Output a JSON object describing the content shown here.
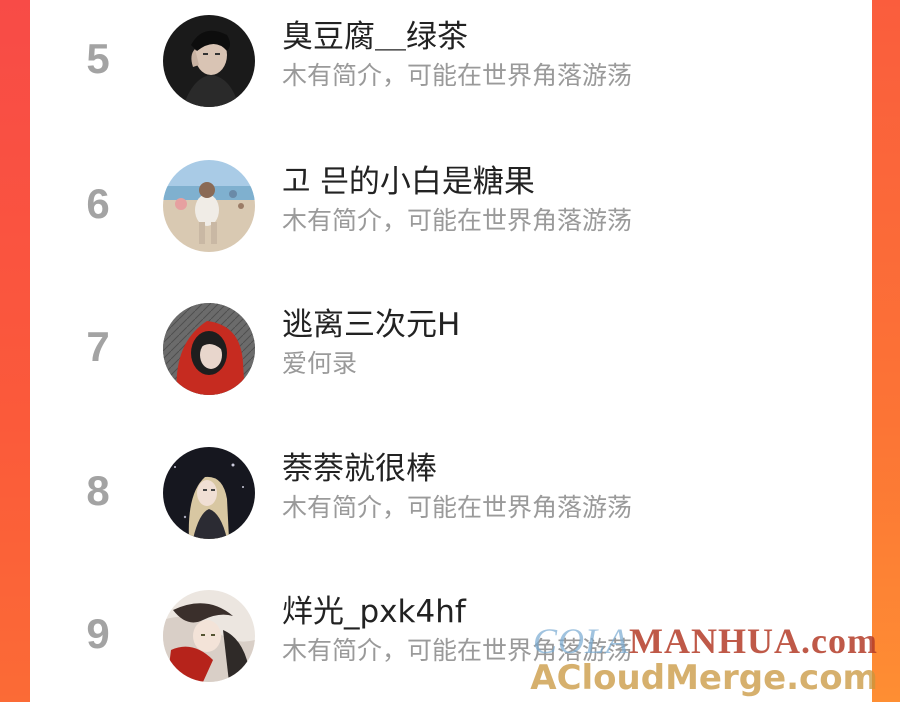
{
  "ranking": [
    {
      "rank": "5",
      "name": "臭豆腐＿绿茶",
      "bio": "木有简介，可能在世界角落游荡",
      "avatar": "avatar-man-portrait-icon"
    },
    {
      "rank": "6",
      "name": "고 믄的小白是糖果",
      "bio": "木有简介，可能在世界角落游荡",
      "avatar": "avatar-beach-photo-icon"
    },
    {
      "rank": "7",
      "name": "逃离三次元H",
      "bio": "爱何录",
      "avatar": "avatar-red-hood-girl-icon"
    },
    {
      "rank": "8",
      "name": "萘萘就很棒",
      "bio": "木有简介，可能在世界角落游荡",
      "avatar": "avatar-night-girl-icon"
    },
    {
      "rank": "9",
      "name": "烊光_pxk4hf",
      "bio": "木有简介，可能在世界角落游荡",
      "avatar": "avatar-anime-art-icon"
    }
  ],
  "watermark": {
    "line1_prefix": "COLA",
    "line1_suffix": "MANHUA.com",
    "line2": "ACloudMerge.com"
  },
  "colors": {
    "accent_orange": "#fb6a36",
    "rank_gray": "#a3a3a3",
    "name_text": "#222222",
    "bio_text": "#9a9a9a"
  }
}
